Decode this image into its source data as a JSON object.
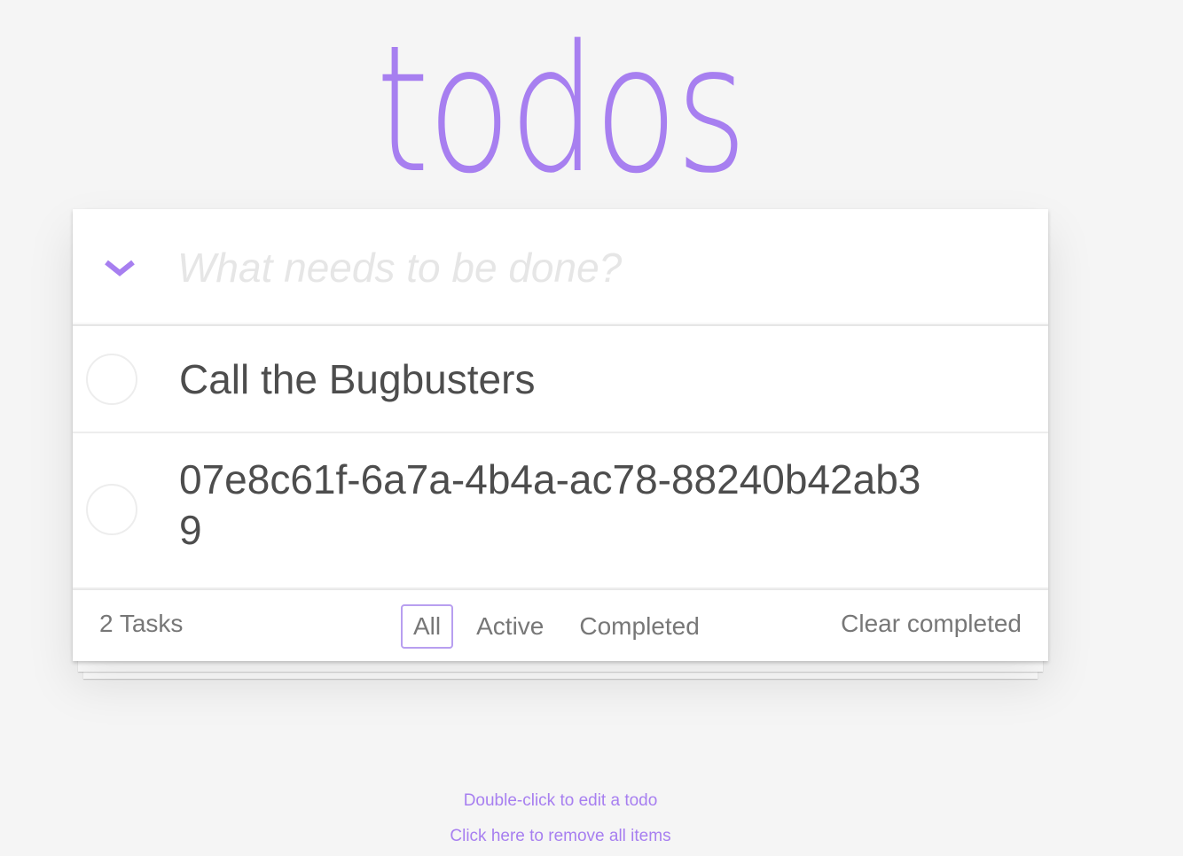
{
  "app": {
    "title": "todos"
  },
  "header": {
    "new_todo_placeholder": "What needs to be done?",
    "new_todo_value": "",
    "toggle_all_icon": "chevron-down-icon"
  },
  "todos": [
    {
      "label": "Call the Bugbusters",
      "completed": false
    },
    {
      "label": "07e8c61f-6a7a-4b4a-ac78-88240b42ab39",
      "completed": false
    }
  ],
  "footer": {
    "count_label": "2 Tasks",
    "filters": [
      {
        "label": "All",
        "selected": true
      },
      {
        "label": "Active",
        "selected": false
      },
      {
        "label": "Completed",
        "selected": false
      }
    ],
    "clear_completed_label": "Clear completed"
  },
  "info": {
    "edit_hint": "Double-click to edit a todo",
    "remove_all_link": "Click here to remove all items"
  },
  "colors": {
    "accent": "#a77ff0",
    "background": "#f5f5f5",
    "panel": "#ffffff",
    "text": "#4d4d4d",
    "muted": "#777777"
  }
}
